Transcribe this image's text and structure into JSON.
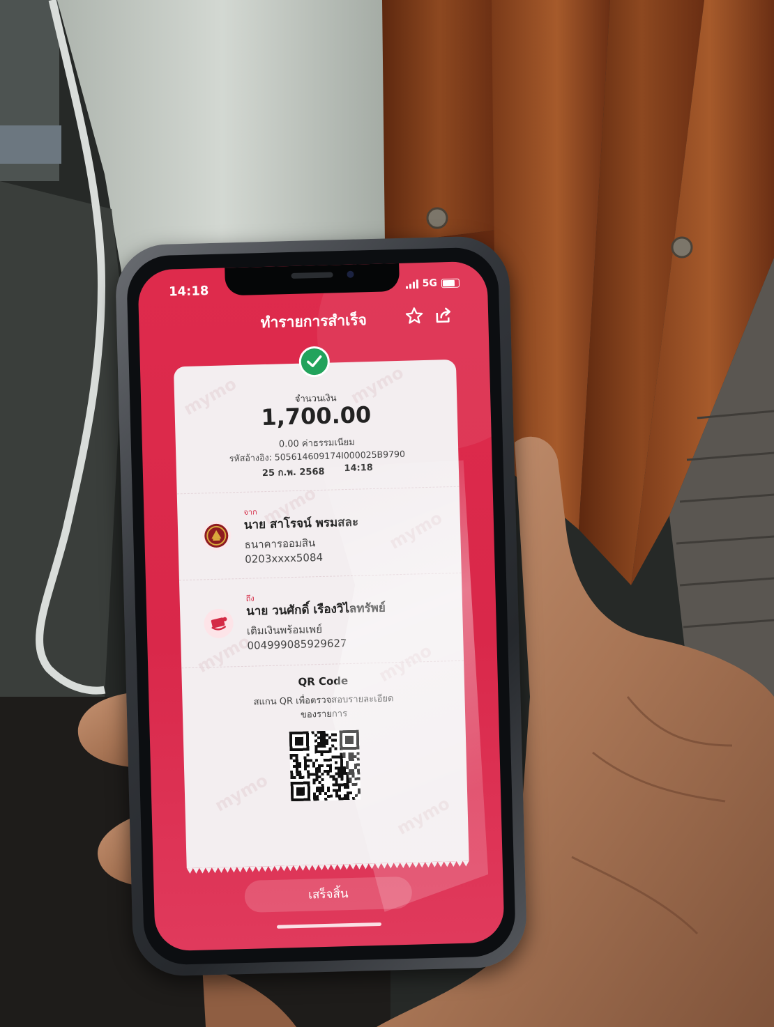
{
  "status_bar": {
    "time": "14:18",
    "network": "5G"
  },
  "header": {
    "title": "ทำรายการสำเร็จ"
  },
  "icons": {
    "favorite": "star-icon",
    "share": "share-icon",
    "status": "check-circle-icon",
    "sender_bank": "gsb-logo-icon",
    "receiver": "wallet-topup-icon"
  },
  "receipt": {
    "watermark": "mymo",
    "amount_label": "จำนวนเงิน",
    "amount": "1,700.00",
    "fee": "0.00 ค่าธรรมเนียม",
    "reference": "รหัสอ้างอิง: 505614609174I000025B9790",
    "date": "25 ก.พ. 2568",
    "time": "14:18",
    "from": {
      "label": "จาก",
      "name": "นาย สาโรจน์ พรมสละ",
      "bank": "ธนาคารออมสิน",
      "account": "0203xxxx5084"
    },
    "to": {
      "label": "ถึง",
      "name": "นาย วนศักดิ์ เรืองวิไลทรัพย์",
      "service": "เติมเงินพร้อมเพย์",
      "account": "004999085929627"
    },
    "qr": {
      "title": "QR Code",
      "description_line1": "สแกน QR เพื่อตรวจสอบรายละเอียด",
      "description_line2": "ของรายการ"
    }
  },
  "footer": {
    "done_label": "เสร็จสิ้น"
  },
  "colors": {
    "primary": "#dc2a4a",
    "success": "#22a35c",
    "label_red": "#d42a45",
    "card": "#f3eef0"
  }
}
